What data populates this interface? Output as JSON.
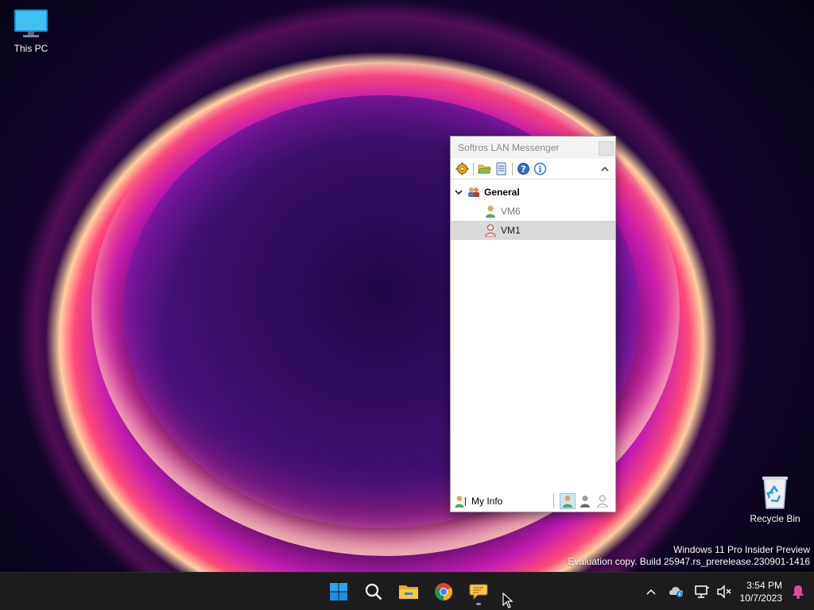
{
  "desktop": {
    "icons": [
      {
        "label": "This PC",
        "icon": "monitor-icon"
      },
      {
        "label": "Recycle Bin",
        "icon": "recycle-bin-icon"
      }
    ],
    "watermark": {
      "line1": "Windows 11 Pro Insider Preview",
      "line2": "Evaluation copy. Build 25947.rs_prerelease.230901-1416"
    }
  },
  "messenger": {
    "title": "Softros LAN Messenger",
    "toolbar": [
      "settings-gear-icon",
      "open-folder-icon",
      "message-history-icon",
      "help-icon",
      "about-info-icon"
    ],
    "group": {
      "label": "General",
      "icon": "group-users-icon"
    },
    "contacts": [
      {
        "label": "VM6",
        "icon": "user-male-icon",
        "selected": false
      },
      {
        "label": "VM1",
        "icon": "user-female-icon",
        "selected": true
      }
    ],
    "status": {
      "my_info_label": "My Info",
      "states": [
        "online",
        "away",
        "offline"
      ],
      "active": "online"
    }
  },
  "taskbar": {
    "apps": [
      "start-icon",
      "search-icon",
      "file-explorer-icon",
      "chrome-icon",
      "messenger-icon"
    ],
    "tray": [
      "show-hidden-icons-chevron",
      "onedrive-icon",
      "network-icon",
      "volume-muted-icon"
    ],
    "time": "3:54 PM",
    "date": "10/7/2023"
  },
  "colors": {
    "selection": "#d9d9d9",
    "taskbar": "#1c1c1c",
    "accent": "#0078d4"
  }
}
